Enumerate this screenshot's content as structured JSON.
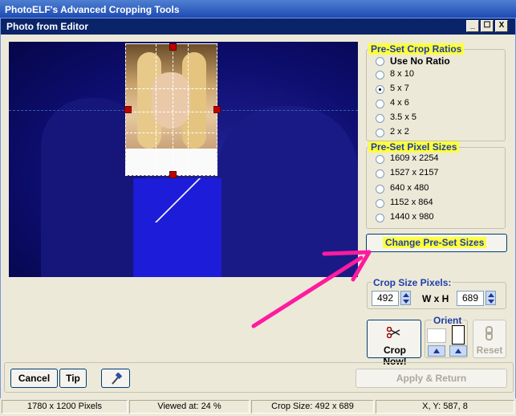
{
  "app": {
    "title": "PhotoELF's Advanced Cropping Tools"
  },
  "window": {
    "title": "Photo from Editor",
    "minimize_glyph": "_",
    "maximize_glyph": "☐",
    "close_glyph": "X"
  },
  "crop_ratios": {
    "title": "Pre-Set Crop Ratios",
    "options": [
      "Use No Ratio",
      "8 x 10",
      "5 x 7",
      "4 x 6",
      "3.5 x 5",
      "2 x 2"
    ],
    "selected": "5 x 7"
  },
  "pixel_sizes": {
    "title": "Pre-Set Pixel Sizes",
    "options": [
      "1609 x 2254",
      "1527 x 2157",
      "640 x 480",
      "1152 x 864",
      "1440 x 980"
    ]
  },
  "change_presets_label": "Change Pre-Set Sizes",
  "crop_size": {
    "title": "Crop Size Pixels:",
    "width": "492",
    "separator": "W x H",
    "height": "689"
  },
  "orient": {
    "title": "Orient"
  },
  "crop_now_label": "Crop Now!",
  "reset_label": "Reset",
  "cancel_label": "Cancel",
  "tip_label": "Tip",
  "apply_label": "Apply & Return",
  "status": {
    "dimensions": "1780 x 1200 Pixels",
    "viewed_at": "Viewed at: 24 %",
    "crop_size": "Crop Size: 492 x 689",
    "xy": "X, Y: 587, 8"
  },
  "colors": {
    "highlight": "#ffff3c",
    "group_text": "#1e3ea8",
    "arrow": "#ff1aa0",
    "handle": "#c00000"
  },
  "icons": {
    "crop": "scissors-icon",
    "tool": "hammer-icon",
    "reset": "reset-chain-icon"
  }
}
